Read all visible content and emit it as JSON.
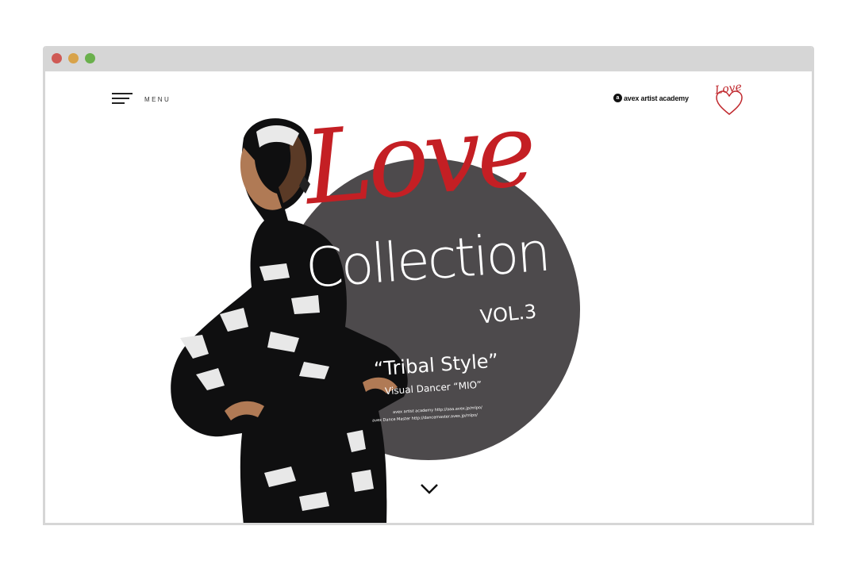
{
  "window": {
    "controls": {
      "close_color": "#cf5a55",
      "minimize_color": "#d8a34a",
      "maximize_color": "#6ab04c"
    }
  },
  "header": {
    "menu_label": "MENU",
    "menu_icon": "hamburger-icon",
    "brand_name": "avex artist academy",
    "brand_mark": "a",
    "logo_text": "Love"
  },
  "hero": {
    "title_love": "Love",
    "title_collection": "Collection",
    "volume": "VOL.3",
    "style": "“Tribal Style”",
    "dancer": "Visual Dancer “MIO”",
    "credits": [
      "avex artist academy http://aaa.avex.jp/mlpo/",
      "avex Dance Master http://dancemaster.avex.jp/mlpo/"
    ],
    "scroll_icon": "chevron-down-icon"
  },
  "colors": {
    "accent_red": "#c41f24",
    "circle_gray": "#4d4a4c",
    "frame_gray": "#d6d6d6"
  }
}
